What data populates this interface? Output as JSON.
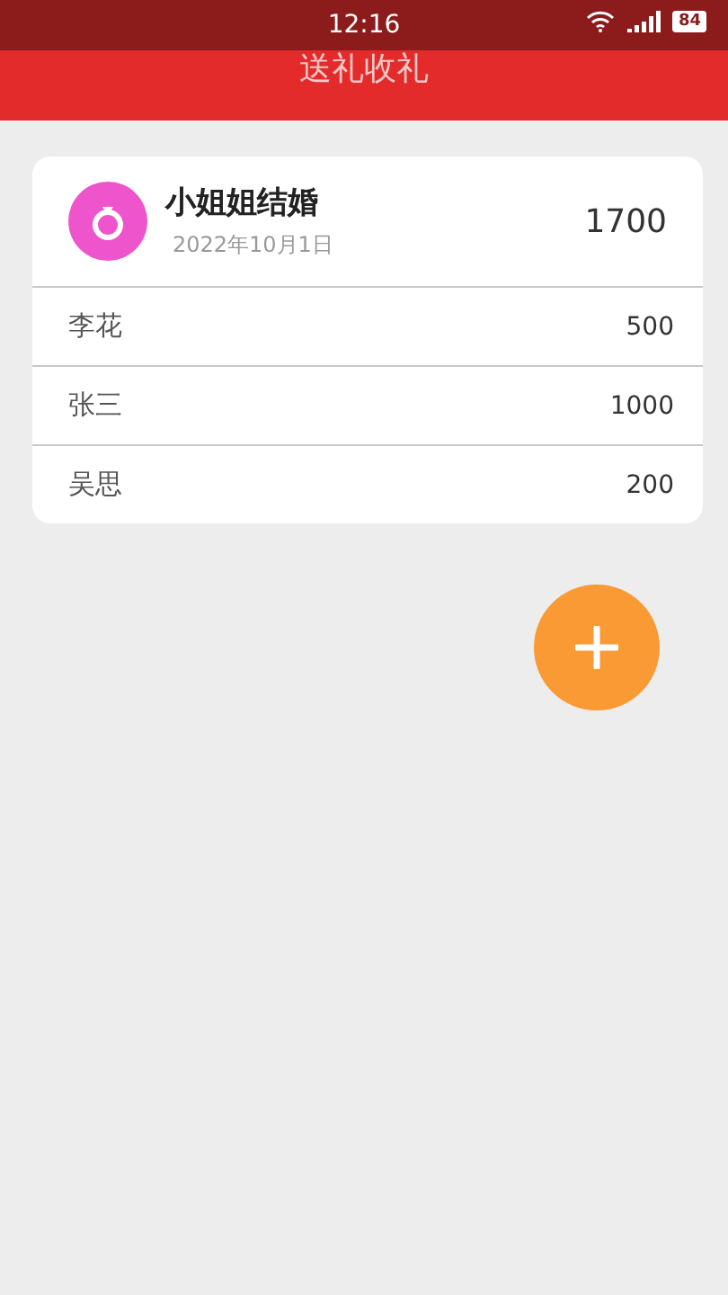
{
  "status_bar": {
    "time": "12:16",
    "battery": "84"
  },
  "header": {
    "title": "送礼收礼"
  },
  "event": {
    "title": "小姐姐结婚",
    "date": "2022年10月1日",
    "total": "1700"
  },
  "gifts": [
    {
      "name": "李花",
      "amount": "500"
    },
    {
      "name": "张三",
      "amount": "1000"
    },
    {
      "name": "吴思",
      "amount": "200"
    }
  ]
}
